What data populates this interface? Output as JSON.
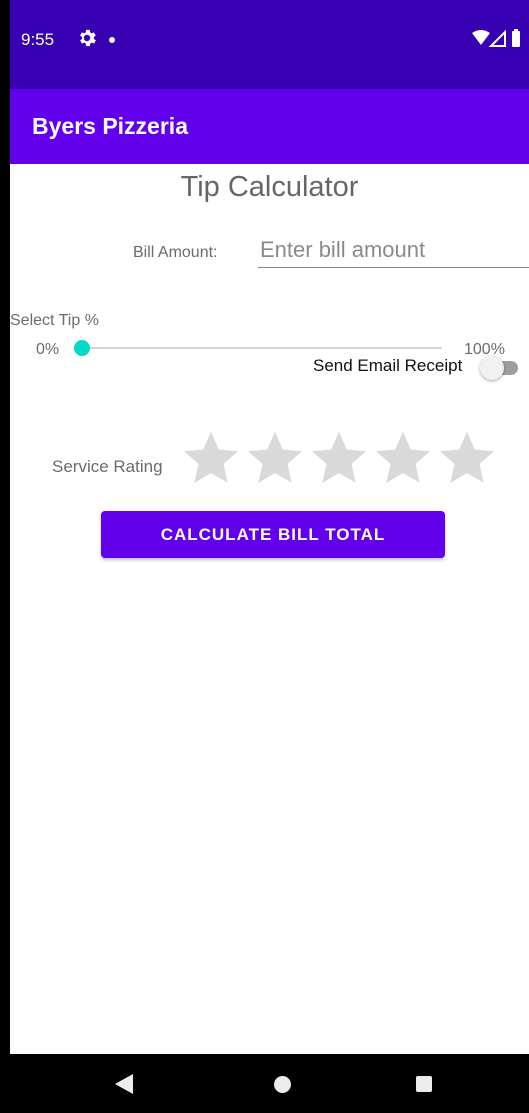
{
  "status_bar": {
    "time": "9:55",
    "icons": [
      "gear-icon",
      "notification-dot-icon",
      "wifi-icon",
      "signal-icon",
      "battery-icon"
    ]
  },
  "app_bar": {
    "title": "Byers Pizzeria"
  },
  "content": {
    "title": "Tip Calculator",
    "bill_label": "Bill Amount:",
    "bill_value": "",
    "bill_placeholder": "Enter bill amount",
    "tip_label": "Select Tip %",
    "tip_min_label": "0%",
    "tip_max_label": "100%",
    "tip_value_percent": 0,
    "email_label": "Send Email Receipt",
    "email_switch_on": false,
    "rating_label": "Service Rating",
    "rating_value": 0,
    "rating_max": 5,
    "calculate_label": "CALCULATE BILL TOTAL"
  },
  "colors": {
    "status_bar": "#3700b3",
    "app_bar": "#6200ee",
    "accent": "#03dac5",
    "star_empty": "#d9d9d9",
    "star_filled": "#03dac5",
    "button": "#6200ee"
  },
  "nav_bar": {
    "icons": [
      "back-icon",
      "home-icon",
      "recents-icon"
    ]
  }
}
